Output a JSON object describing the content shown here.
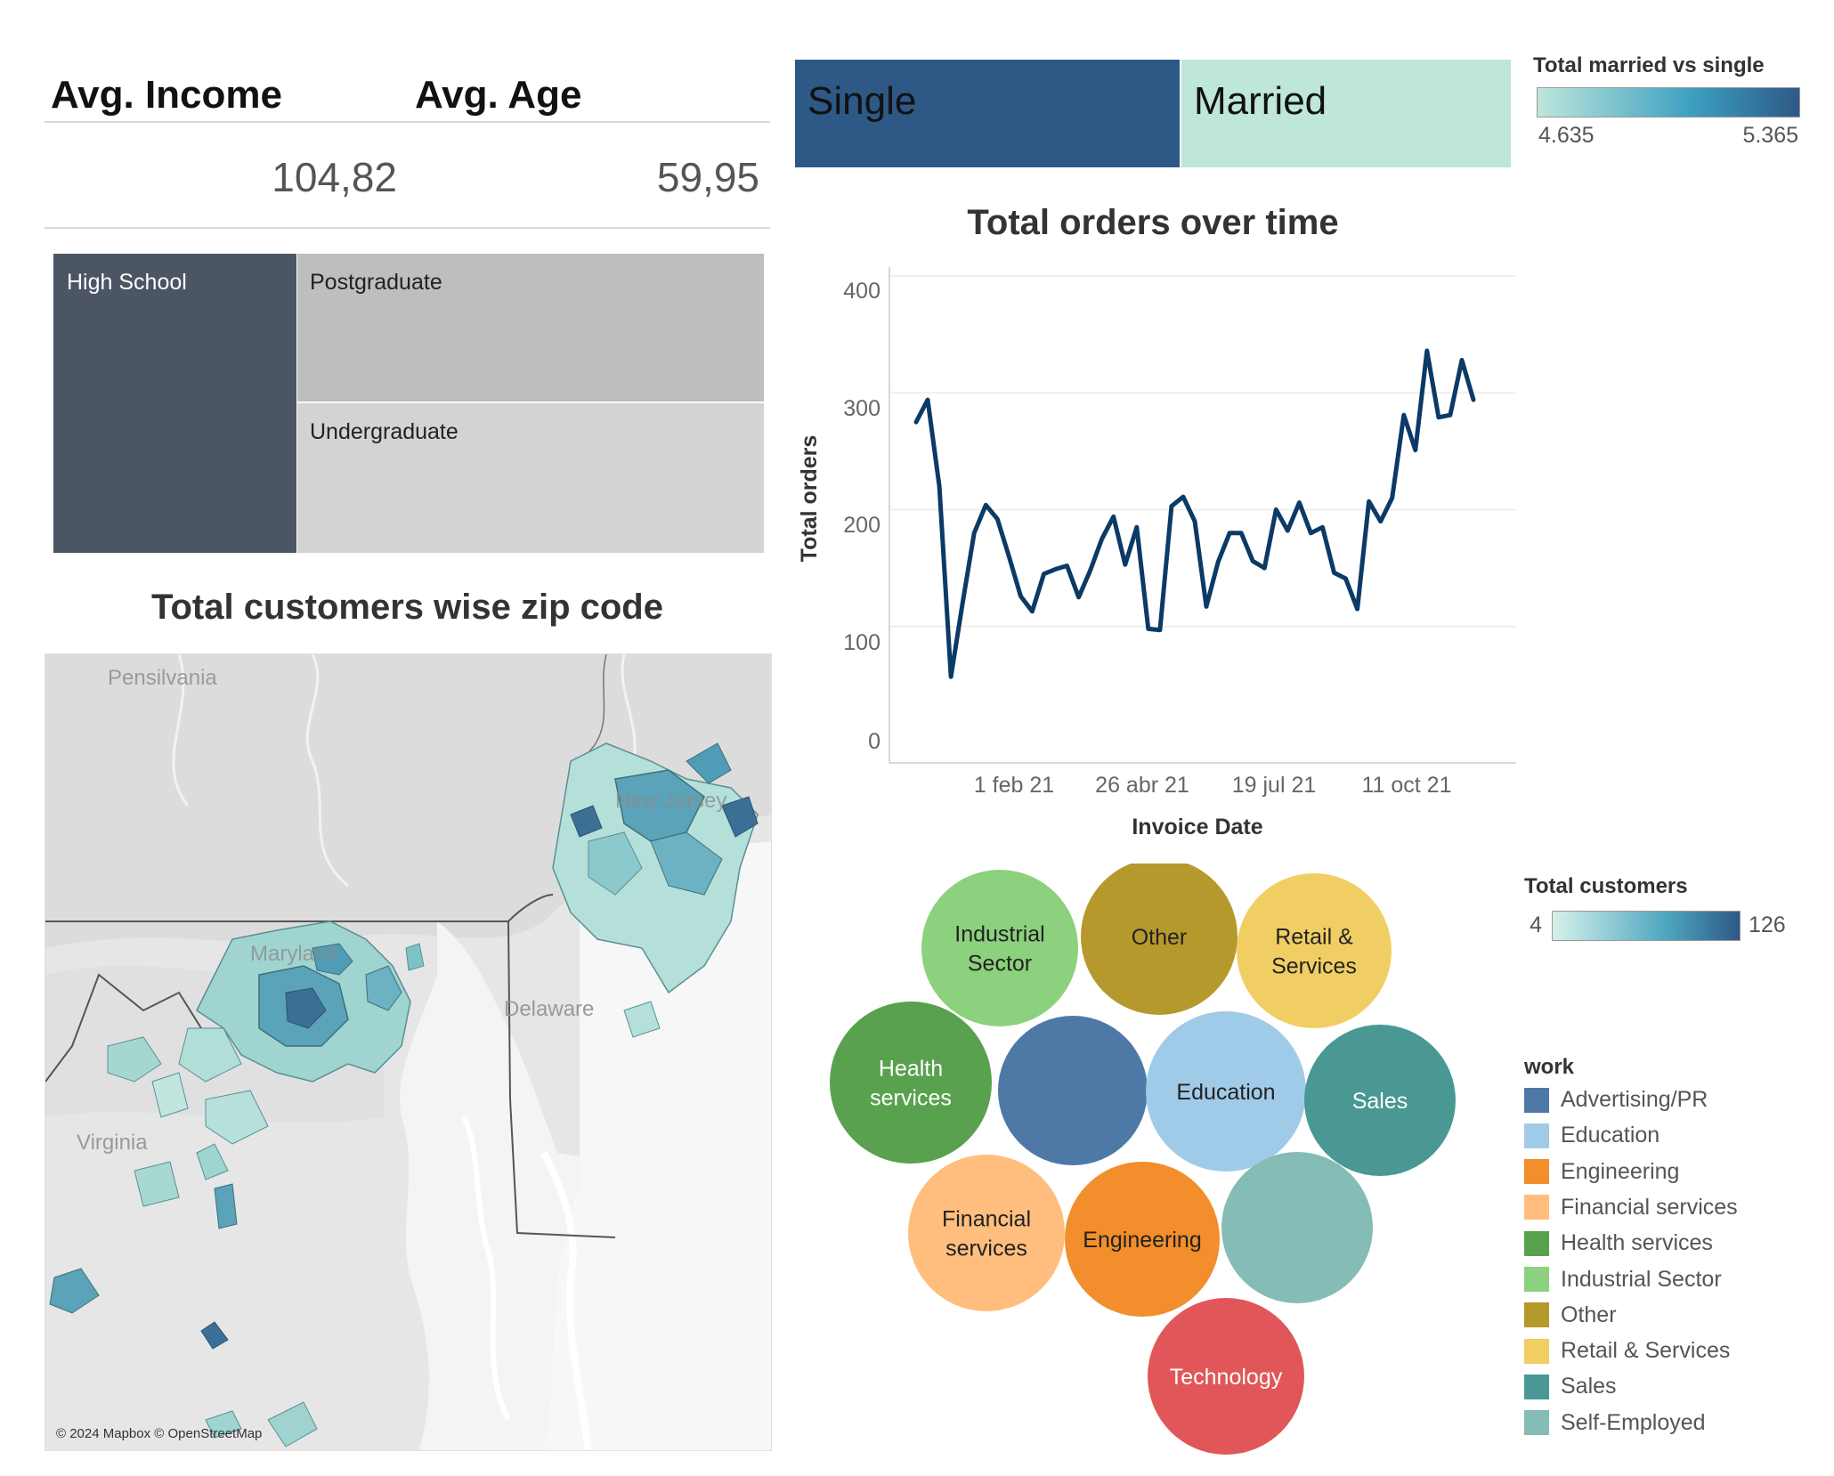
{
  "kpis": {
    "income_label": "Avg. Income",
    "age_label": "Avg. Age",
    "income_value": "104,82",
    "age_value": "59,95"
  },
  "education_treemap": [
    {
      "label": "High School",
      "color": "#4b5563"
    },
    {
      "label": "Postgraduate",
      "color": "#bdbebf"
    },
    {
      "label": "Undergraduate",
      "color": "#d3d3d3"
    }
  ],
  "marital": {
    "single_label": "Single",
    "married_label": "Married",
    "single_color": "#2e5986",
    "married_color": "#bee6db",
    "legend_title": "Total married vs single",
    "legend_min": "4.635",
    "legend_max": "5.365"
  },
  "map": {
    "title": "Total customers wise zip code",
    "labels": {
      "pensilvania": "Pensilvania",
      "new_jersey": "New Jersey",
      "maryland": "Maryland",
      "delaware": "Delaware",
      "virginia": "Virginia"
    },
    "attribution": "© 2024 Mapbox © OpenStreetMap"
  },
  "bubble": {
    "legend_title": "Total customers",
    "legend_min": "4",
    "legend_max": "126",
    "work_title": "work",
    "items": [
      {
        "label": "Advertising/PR",
        "bubble": "",
        "color": "#4e79a7",
        "text": "#ffffff"
      },
      {
        "label": "Education",
        "bubble": "Education",
        "color": "#a0cbe8",
        "text": "#222222"
      },
      {
        "label": "Engineering",
        "bubble": "Engineering",
        "color": "#f28e2b",
        "text": "#222222"
      },
      {
        "label": "Financial services",
        "bubble": "Financial\nservices",
        "color": "#ffbe7d",
        "text": "#222222"
      },
      {
        "label": "Health services",
        "bubble": "Health\nservices",
        "color": "#59a14f",
        "text": "#ffffff"
      },
      {
        "label": "Industrial Sector",
        "bubble": "Industrial\nSector",
        "color": "#8cd17d",
        "text": "#222222"
      },
      {
        "label": "Other",
        "bubble": "Other",
        "color": "#b6992d",
        "text": "#222222"
      },
      {
        "label": "Retail & Services",
        "bubble": "Retail &\nServices",
        "color": "#f1ce63",
        "text": "#222222"
      },
      {
        "label": "Sales",
        "bubble": "Sales",
        "color": "#499894",
        "text": "#ffffff"
      },
      {
        "label": "Self-Employed",
        "bubble": "",
        "color": "#86bcb6",
        "text": "#222222"
      },
      {
        "label": "Technology",
        "bubble": "Technology",
        "color": "#e15759",
        "text": "#ffffff"
      }
    ]
  },
  "chart_data": {
    "type": "line",
    "title": "Total orders over time",
    "xlabel": "Invoice Date",
    "ylabel": "Total orders",
    "x_tick_labels": [
      "1 feb 21",
      "26 abr 21",
      "19 jul 21",
      "11 oct 21"
    ],
    "y_tick_labels": [
      "0",
      "100",
      "200",
      "300",
      "400"
    ],
    "ylim": [
      0,
      400
    ],
    "grid": true,
    "line_color": "#0b3a66",
    "series": [
      {
        "x": [
          "2021-01-04",
          "2021-01-11",
          "2021-01-18",
          "2021-01-25",
          "2021-02-01",
          "2021-02-08",
          "2021-02-15",
          "2021-02-22",
          "2021-03-01",
          "2021-03-08",
          "2021-03-15",
          "2021-03-22",
          "2021-03-29",
          "2021-04-05",
          "2021-04-12",
          "2021-04-19",
          "2021-04-26",
          "2021-05-03",
          "2021-05-10",
          "2021-05-17",
          "2021-05-24",
          "2021-05-31",
          "2021-06-07",
          "2021-06-14",
          "2021-06-21",
          "2021-06-28",
          "2021-07-05",
          "2021-07-12",
          "2021-07-19",
          "2021-07-26",
          "2021-08-02",
          "2021-08-09",
          "2021-08-16",
          "2021-08-23",
          "2021-08-30",
          "2021-09-06",
          "2021-09-13",
          "2021-09-20",
          "2021-09-27",
          "2021-10-04",
          "2021-10-11",
          "2021-10-18",
          "2021-10-25",
          "2021-11-01",
          "2021-11-08",
          "2021-11-15",
          "2021-11-22",
          "2021-11-29",
          "2021-12-06"
        ],
        "values": [
          275,
          294,
          220,
          57,
          120,
          180,
          204,
          192,
          160,
          126,
          113,
          145,
          149,
          152,
          125,
          148,
          175,
          194,
          153,
          185,
          98,
          97,
          203,
          211,
          190,
          117,
          155,
          180,
          180,
          156,
          150,
          200,
          182,
          206,
          180,
          185,
          146,
          141,
          115,
          207,
          190,
          210,
          281,
          251,
          336,
          279,
          281,
          328,
          294
        ]
      }
    ]
  }
}
